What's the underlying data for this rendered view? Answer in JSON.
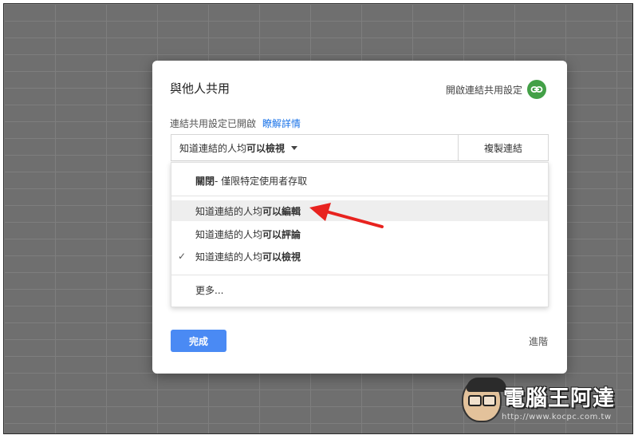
{
  "dialog": {
    "title": "與他人共用",
    "link_settings_label": "開啟連結共用設定",
    "status_text": "連結共用設定已開啟",
    "learn_more": "瞭解詳情",
    "access_prefix": "知道連結的人均",
    "access_value": "可以檢視",
    "copy_link": "複製連結",
    "done": "完成",
    "advanced": "進階"
  },
  "menu": {
    "off": {
      "bold": "關閉",
      "rest": " - 僅限特定使用者存取"
    },
    "options": [
      {
        "prefix": "知道連結的人均",
        "bold": "可以編輯",
        "highlighted": true,
        "checked": false
      },
      {
        "prefix": "知道連結的人均",
        "bold": "可以評論",
        "highlighted": false,
        "checked": false
      },
      {
        "prefix": "知道連結的人均",
        "bold": "可以檢視",
        "highlighted": false,
        "checked": true
      }
    ],
    "more": "更多...",
    "check_glyph": "✓"
  },
  "watermark": {
    "text": "電腦王阿達",
    "url": "http://www.kocpc.com.tw"
  },
  "colors": {
    "accent": "#4a8af4",
    "link_blue": "#1a73e8",
    "link_icon_green": "#43a047",
    "annotation_arrow": "#e8231f"
  },
  "icons": {
    "link_settings": "link-icon",
    "menu_caret": "caret-down-icon",
    "checked": "checkmark-icon",
    "annotation": "red-arrow-icon"
  }
}
